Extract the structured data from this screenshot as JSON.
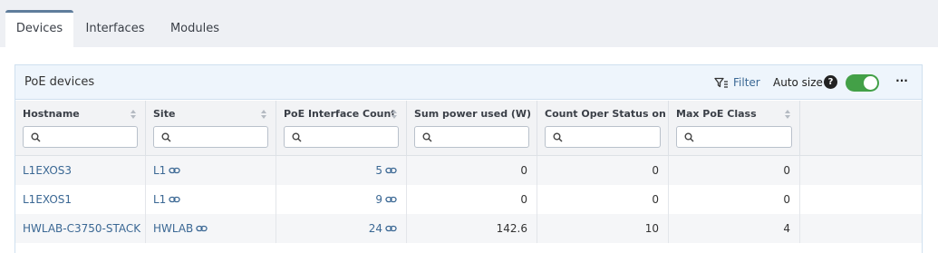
{
  "tabs": [
    {
      "label": "Devices",
      "active": true
    },
    {
      "label": "Interfaces",
      "active": false
    },
    {
      "label": "Modules",
      "active": false
    }
  ],
  "panel": {
    "title": "PoE devices",
    "filter_label": "Filter",
    "autosize_label": "Auto size",
    "help_label": "?",
    "more_label": "···",
    "autosize_enabled": true
  },
  "table": {
    "columns": [
      {
        "label": "Hostname",
        "filter_value": ""
      },
      {
        "label": "Site",
        "filter_value": ""
      },
      {
        "label": "PoE Interface Count",
        "filter_value": ""
      },
      {
        "label": "Sum power used (W)",
        "filter_value": ""
      },
      {
        "label": "Count Oper Status on",
        "filter_value": ""
      },
      {
        "label": "Max PoE Class",
        "filter_value": ""
      }
    ],
    "rows": [
      {
        "hostname": "L1EXOS3",
        "site": "L1",
        "poe_interface_count": "5",
        "sum_power_used": "0",
        "count_oper_status_on": "0",
        "max_poe_class": "0"
      },
      {
        "hostname": "L1EXOS1",
        "site": "L1",
        "poe_interface_count": "9",
        "sum_power_used": "0",
        "count_oper_status_on": "0",
        "max_poe_class": "0"
      },
      {
        "hostname": "HWLAB-C3750-STACK",
        "site": "HWLAB",
        "poe_interface_count": "24",
        "sum_power_used": "142.6",
        "count_oper_status_on": "10",
        "max_poe_class": "4"
      }
    ]
  },
  "colors": {
    "link": "#3b6894",
    "toggle_on": "#43a047",
    "header_bg": "#eef5fc",
    "tab_active_border": "#5f7d9c"
  }
}
